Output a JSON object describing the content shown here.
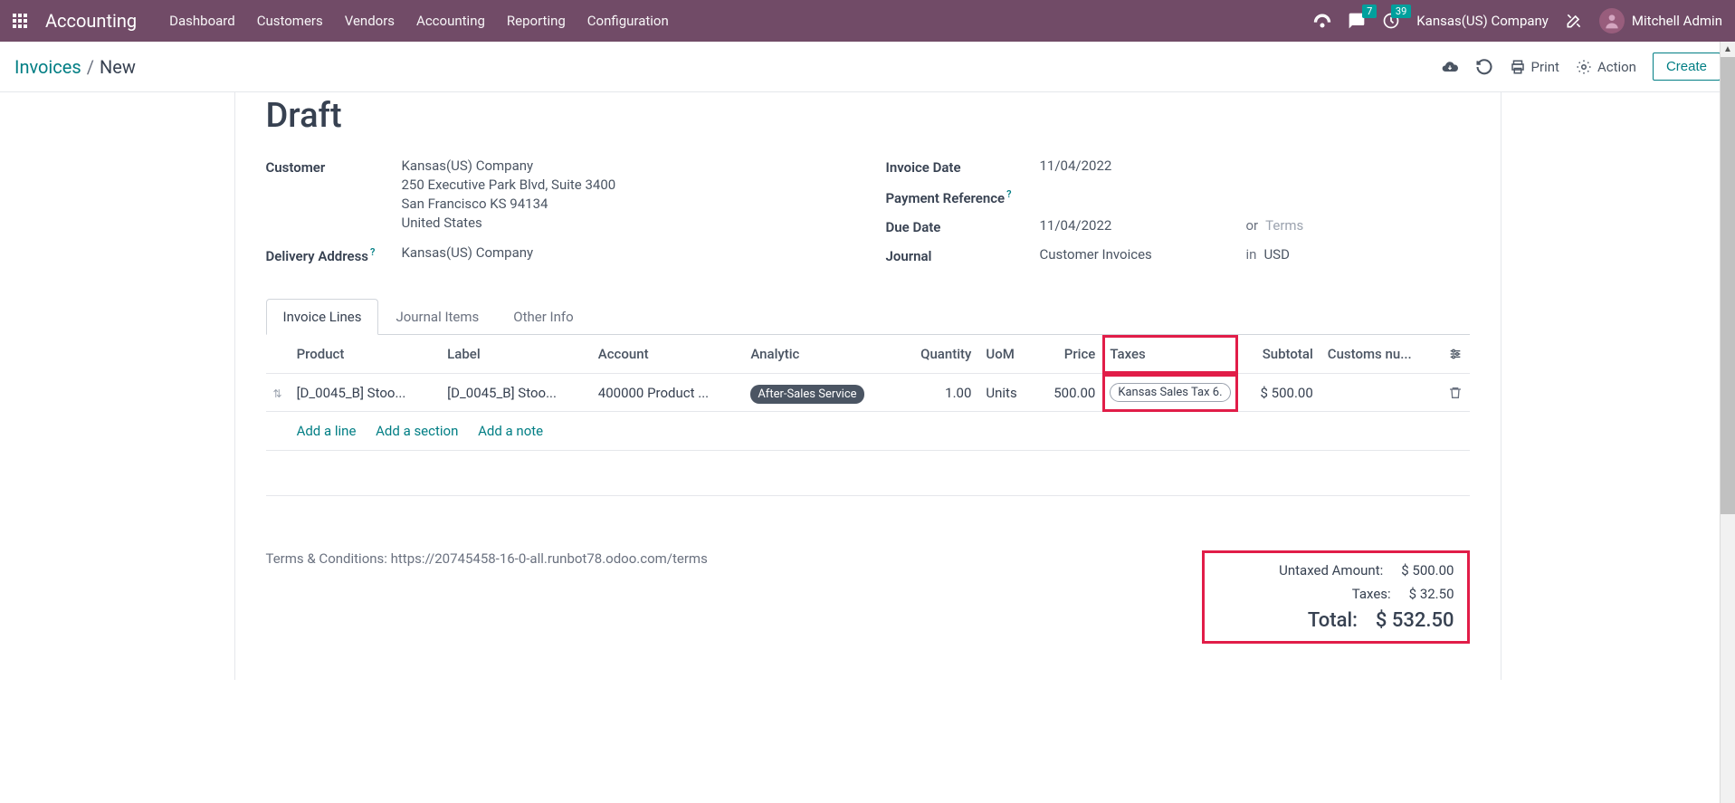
{
  "topbar": {
    "app_title": "Accounting",
    "nav": [
      "Dashboard",
      "Customers",
      "Vendors",
      "Accounting",
      "Reporting",
      "Configuration"
    ],
    "messages_badge": "7",
    "activities_badge": "39",
    "company": "Kansas(US) Company",
    "user": "Mitchell Admin"
  },
  "controlbar": {
    "breadcrumb_root": "Invoices",
    "breadcrumb_current": "New",
    "print_label": "Print",
    "action_label": "Action",
    "create_label": "Create"
  },
  "form": {
    "status": "Draft",
    "customer_label": "Customer",
    "customer_name": "Kansas(US) Company",
    "customer_addr1": "250 Executive Park Blvd, Suite 3400",
    "customer_addr2": "San Francisco KS 94134",
    "customer_country": "United States",
    "delivery_label": "Delivery Address",
    "delivery_value": "Kansas(US) Company",
    "invoice_date_label": "Invoice Date",
    "invoice_date": "11/04/2022",
    "payment_ref_label": "Payment Reference",
    "due_date_label": "Due Date",
    "due_date": "11/04/2022",
    "or_text": "or",
    "terms_placeholder": "Terms",
    "journal_label": "Journal",
    "journal_value": "Customer Invoices",
    "in_text": "in",
    "currency": "USD"
  },
  "tabs": {
    "invoice_lines": "Invoice Lines",
    "journal_items": "Journal Items",
    "other_info": "Other Info"
  },
  "table": {
    "headers": {
      "product": "Product",
      "label": "Label",
      "account": "Account",
      "analytic": "Analytic",
      "quantity": "Quantity",
      "uom": "UoM",
      "price": "Price",
      "taxes": "Taxes",
      "subtotal": "Subtotal",
      "customs": "Customs nu..."
    },
    "row": {
      "product": "[D_0045_B] Stoo...",
      "label": "[D_0045_B] Stoo...",
      "account": "400000 Product ...",
      "analytic": "After-Sales Service",
      "quantity": "1.00",
      "uom": "Units",
      "price": "500.00",
      "tax": "Kansas Sales Tax 6.",
      "subtotal": "$ 500.00"
    },
    "add_line": "Add a line",
    "add_section": "Add a section",
    "add_note": "Add a note"
  },
  "footer": {
    "terms_text": "Terms & Conditions: https://20745458-16-0-all.runbot78.odoo.com/terms",
    "untaxed_label": "Untaxed Amount:",
    "untaxed_value": "$ 500.00",
    "taxes_label": "Taxes:",
    "taxes_value": "$ 32.50",
    "total_label": "Total:",
    "total_value": "$ 532.50"
  }
}
